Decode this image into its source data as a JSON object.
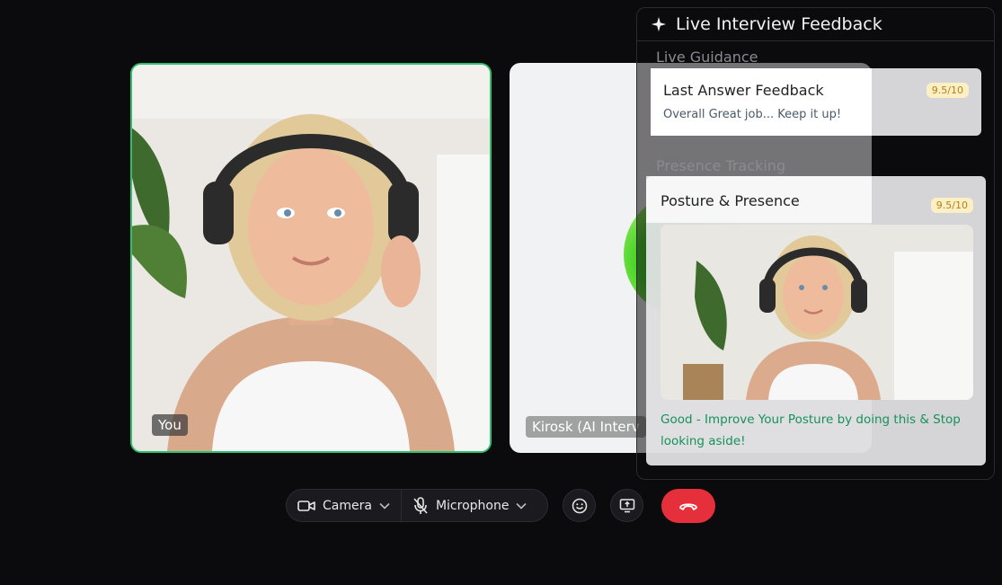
{
  "tiles": {
    "you_label": "You",
    "ai_label": "Kirosk (AI Interv"
  },
  "panel": {
    "title": "Live Interview Feedback",
    "icon": "sparkle-icon",
    "guidance_label": "Live Guidance",
    "answer_card": {
      "title": "Last Answer Feedback",
      "subtitle": "Overall Great job... Keep it up!",
      "score": "9.5/10"
    },
    "presence_label": "Presence Tracking",
    "posture_card": {
      "title": "Posture & Presence",
      "score": "9.5/10",
      "message": "Good - Improve Your Posture by doing this & Stop looking aside!"
    }
  },
  "controls": {
    "camera_label": "Camera",
    "microphone_label": "Microphone",
    "camera_icon": "camera-icon",
    "microphone_icon": "mic-off-icon",
    "emoji_icon": "smiley-icon",
    "share_icon": "screen-share-icon",
    "hangup_icon": "hang-up-icon"
  },
  "colors": {
    "background": "#0b0b0d",
    "active_border": "#2fbf71",
    "hangup": "#e5303b",
    "score_bg": "#fdefc4",
    "success_text": "#17915a"
  }
}
